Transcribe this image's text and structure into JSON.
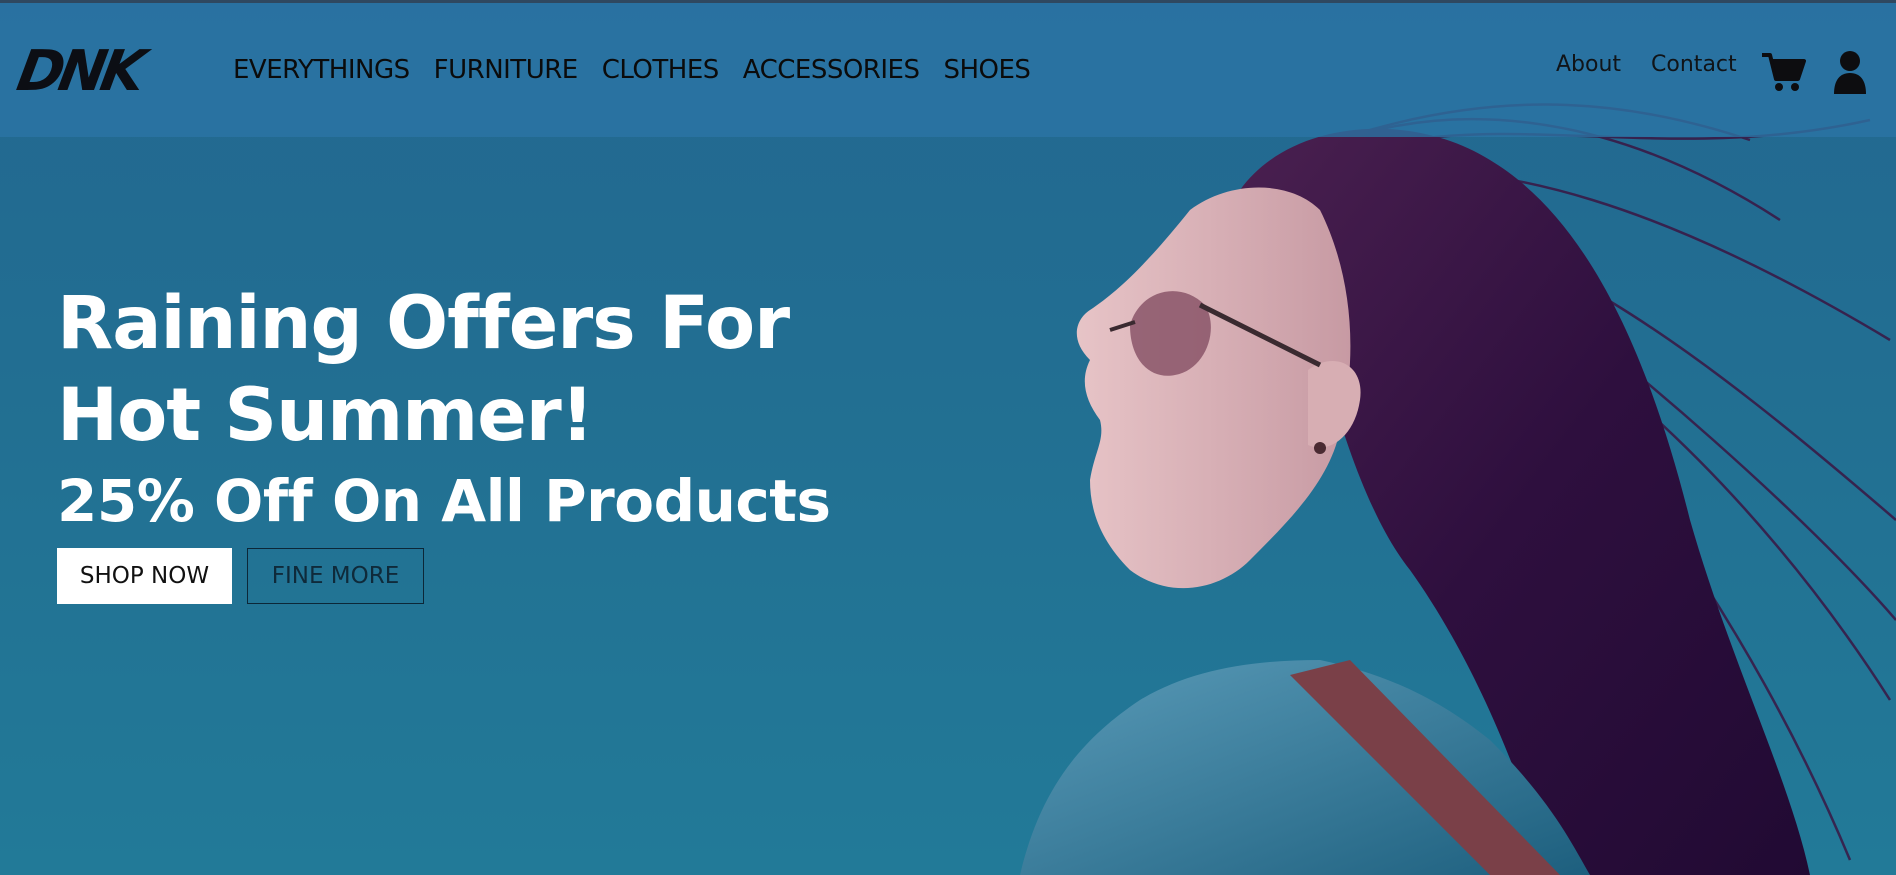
{
  "header": {
    "logo_text": "DNK",
    "nav_items": [
      {
        "label": "EVERYTHINGS"
      },
      {
        "label": "FURNITURE"
      },
      {
        "label": "CLOTHES"
      },
      {
        "label": "ACCESSORIES"
      },
      {
        "label": "SHOES"
      }
    ],
    "right_links": [
      {
        "label": "About"
      },
      {
        "label": "Contact"
      }
    ],
    "icons": [
      "cart-icon",
      "user-icon"
    ]
  },
  "hero": {
    "headline_line1": "Raining Offers For",
    "headline_line2": "Hot Summer!",
    "subheadline": "25% Off On All Products",
    "primary_button": "SHOP NOW",
    "secondary_button": "FINE MORE",
    "image": "woman-with-sunglasses-photo"
  },
  "colors": {
    "background": "#226f93",
    "header": "#2b74a5",
    "text_light": "#ffffff",
    "text_dark": "#0b0b0b"
  }
}
